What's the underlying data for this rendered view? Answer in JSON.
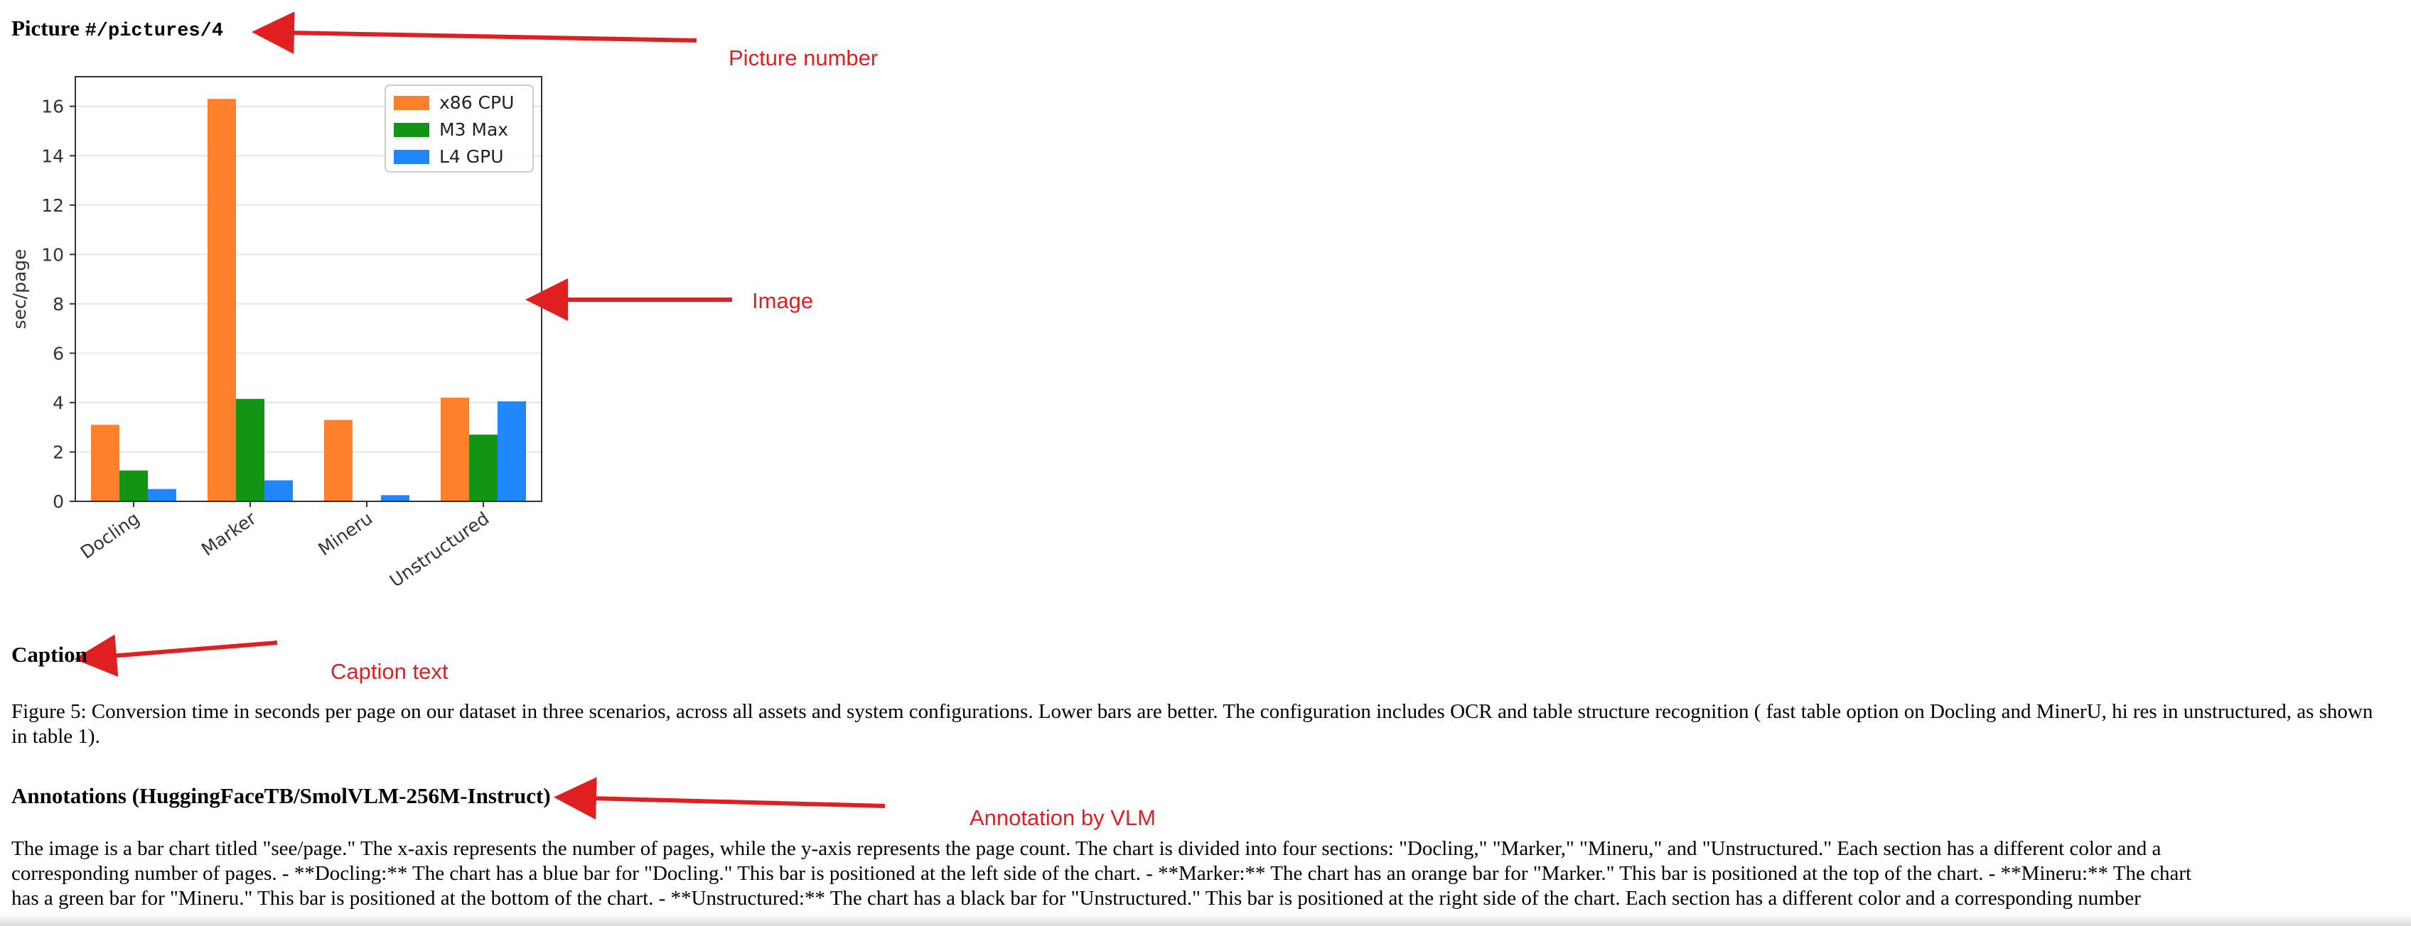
{
  "picture_heading": {
    "prefix": "Picture",
    "ref": "#/pictures/4"
  },
  "callouts": {
    "picture_number": "Picture number",
    "image": "Image",
    "caption_text": "Caption text",
    "annotation": "Annotation by VLM"
  },
  "caption_heading": "Caption",
  "caption_text": "Figure 5: Conversion time in seconds per page on our dataset in three scenarios, across all assets and system configurations. Lower bars are better. The configuration includes OCR and table structure recognition ( fast table option on Docling and MinerU, hi res in unstructured, as shown in table 1).",
  "annotations_heading": "Annotations (HuggingFaceTB/SmolVLM-256M-Instruct)",
  "annotation_lines": [
    "The image is a bar chart titled \"see/page.\" The x-axis represents the number of pages, while the y-axis represents the page count. The chart is divided into four sections: \"Docling,\" \"Marker,\" \"Mineru,\" and \"Unstructured.\" Each section has a different color and a",
    "corresponding number of pages. - **Docling:** The chart has a blue bar for \"Docling.\" This bar is positioned at the left side of the chart. - **Marker:** The chart has an orange bar for \"Marker.\" This bar is positioned at the top of the chart. - **Mineru:** The chart",
    "has a green bar for \"Mineru.\" This bar is positioned at the bottom of the chart. - **Unstructured:** The chart has a black bar for \"Unstructured.\" This bar is positioned at the right side of the chart. Each section has a different color and a corresponding number"
  ],
  "chart_data": {
    "type": "bar",
    "categories": [
      "Docling",
      "Marker",
      "Mineru",
      "Unstructured"
    ],
    "series": [
      {
        "name": "x86 CPU",
        "color": "#ff7f2a",
        "values": [
          3.1,
          16.3,
          3.3,
          4.2
        ]
      },
      {
        "name": "M3 Max",
        "color": "#149414",
        "values": [
          1.25,
          4.15,
          0,
          2.7
        ]
      },
      {
        "name": "L4 GPU",
        "color": "#1e87ff",
        "values": [
          0.5,
          0.85,
          0.25,
          4.05
        ]
      }
    ],
    "title": "",
    "xlabel": "",
    "ylabel": "sec/page",
    "ylim": [
      0,
      17.2
    ],
    "yticks": [
      0,
      2,
      4,
      6,
      8,
      10,
      12,
      14,
      16
    ],
    "grid": "horizontal",
    "legend": "top-right"
  },
  "colors": {
    "callout": "#e02020",
    "grid": "#e6e6e6",
    "axis": "#333333"
  }
}
